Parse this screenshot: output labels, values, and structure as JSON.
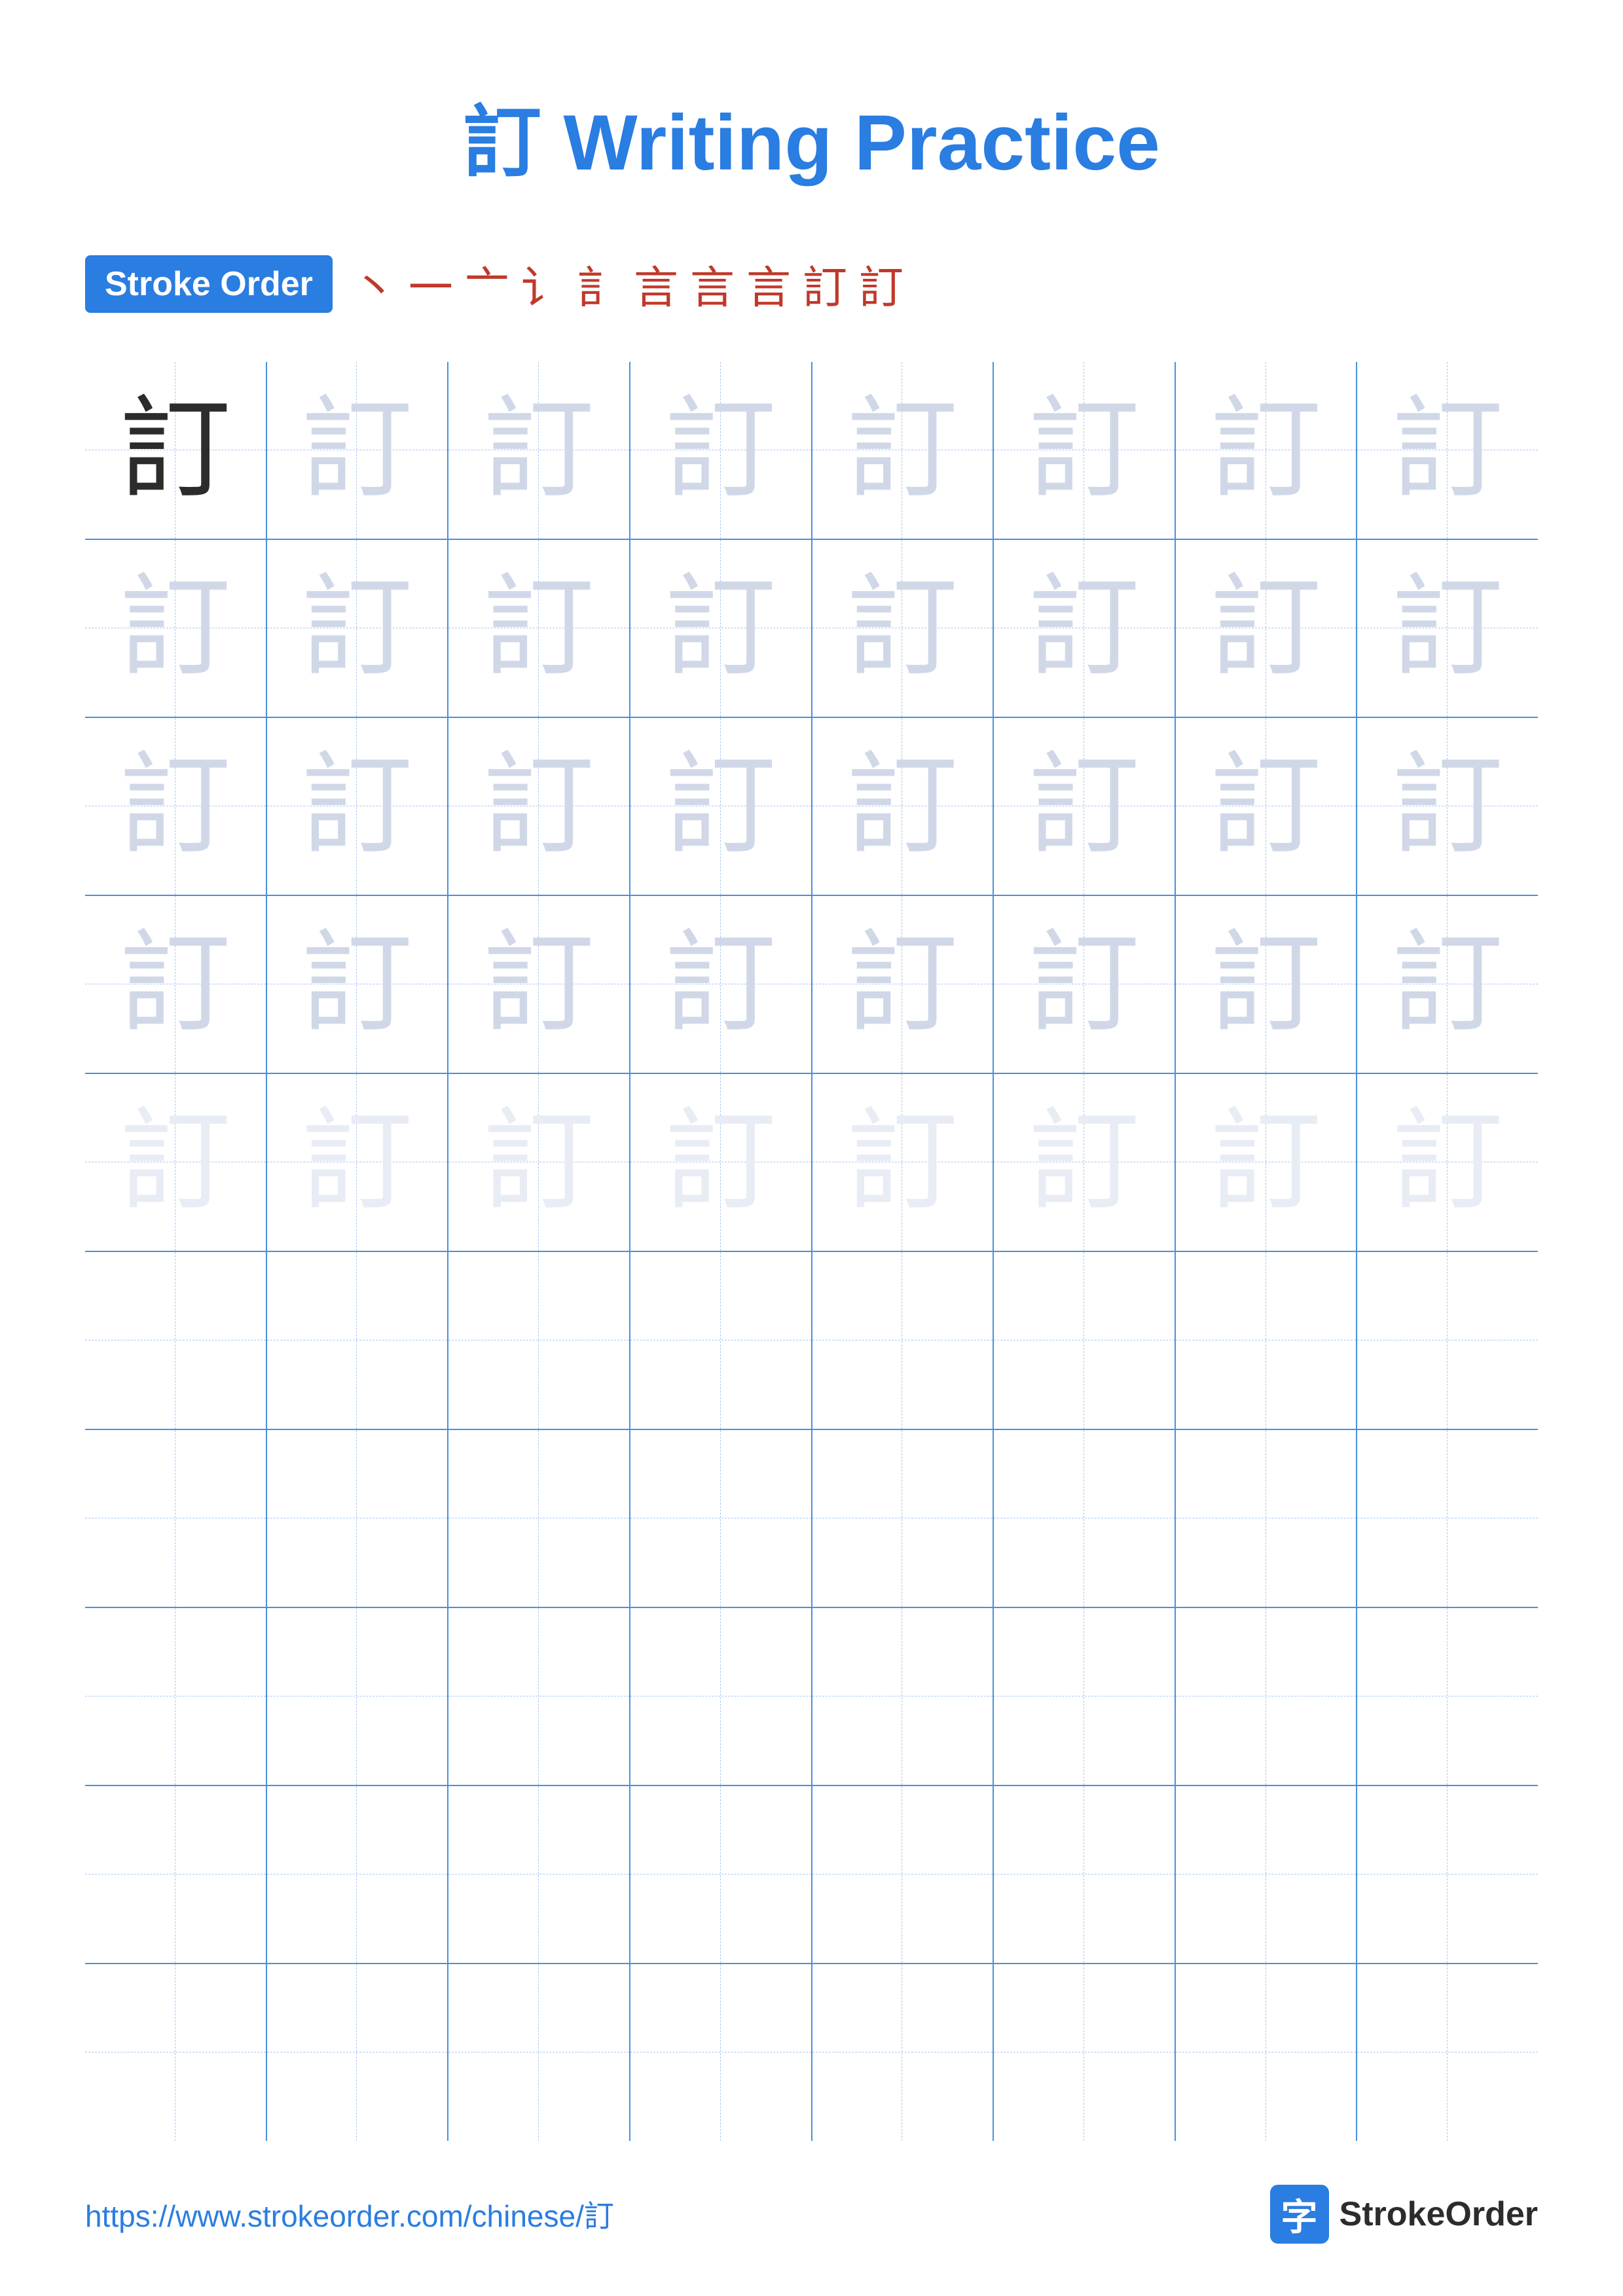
{
  "page": {
    "title": "訂 Writing Practice",
    "title_color": "#2a7de1"
  },
  "stroke_order": {
    "badge_label": "Stroke Order",
    "sequence": [
      "丶",
      "一",
      "亠",
      "讠",
      "訁",
      "言",
      "言",
      "言",
      "訂",
      "訂"
    ]
  },
  "grid": {
    "rows": 10,
    "cols": 8,
    "character": "訂",
    "practice_rows": 5,
    "empty_rows": 5
  },
  "footer": {
    "url": "https://www.strokeorder.com/chinese/訂",
    "logo_char": "字",
    "logo_text": "StrokeOrder"
  }
}
